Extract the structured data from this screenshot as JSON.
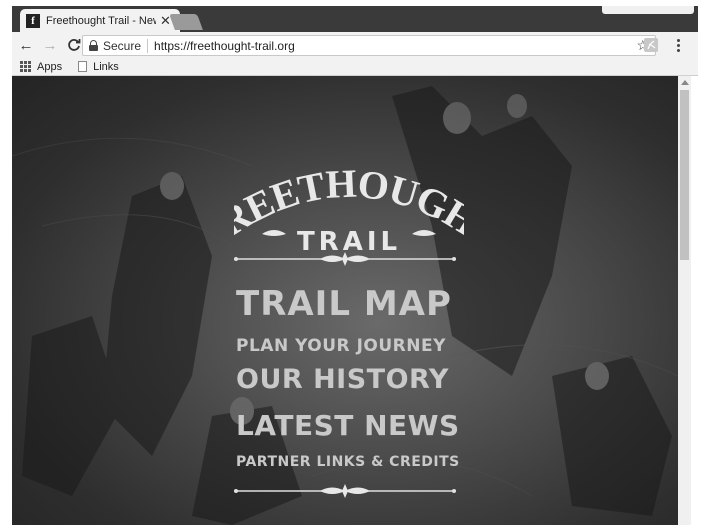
{
  "browser": {
    "tab": {
      "favicon": "f",
      "title": "Freethought Trail - New",
      "close": "✕"
    },
    "toolbar": {
      "back": "←",
      "forward": "→",
      "reload": "C",
      "secure_label": "Secure",
      "url": "https://freethought-trail.org",
      "star": "☆"
    },
    "bookmarks": [
      {
        "label": "Apps",
        "icon": "apps-grid-icon"
      },
      {
        "label": "Links",
        "icon": "page-icon"
      }
    ]
  },
  "site": {
    "logo": {
      "line1": "FREETHOUGHT",
      "line2": "TRAIL"
    },
    "nav": [
      {
        "label": "TRAIL MAP"
      },
      {
        "label": "PLAN YOUR JOURNEY"
      },
      {
        "label": "OUR HISTORY"
      },
      {
        "label": "LATEST NEWS"
      },
      {
        "label": "PARTNER LINKS & CREDITS"
      }
    ]
  },
  "colors": {
    "nav_text": "#c9c9c9",
    "background": "#2e2e2e",
    "chrome": "#f2f2f2"
  }
}
